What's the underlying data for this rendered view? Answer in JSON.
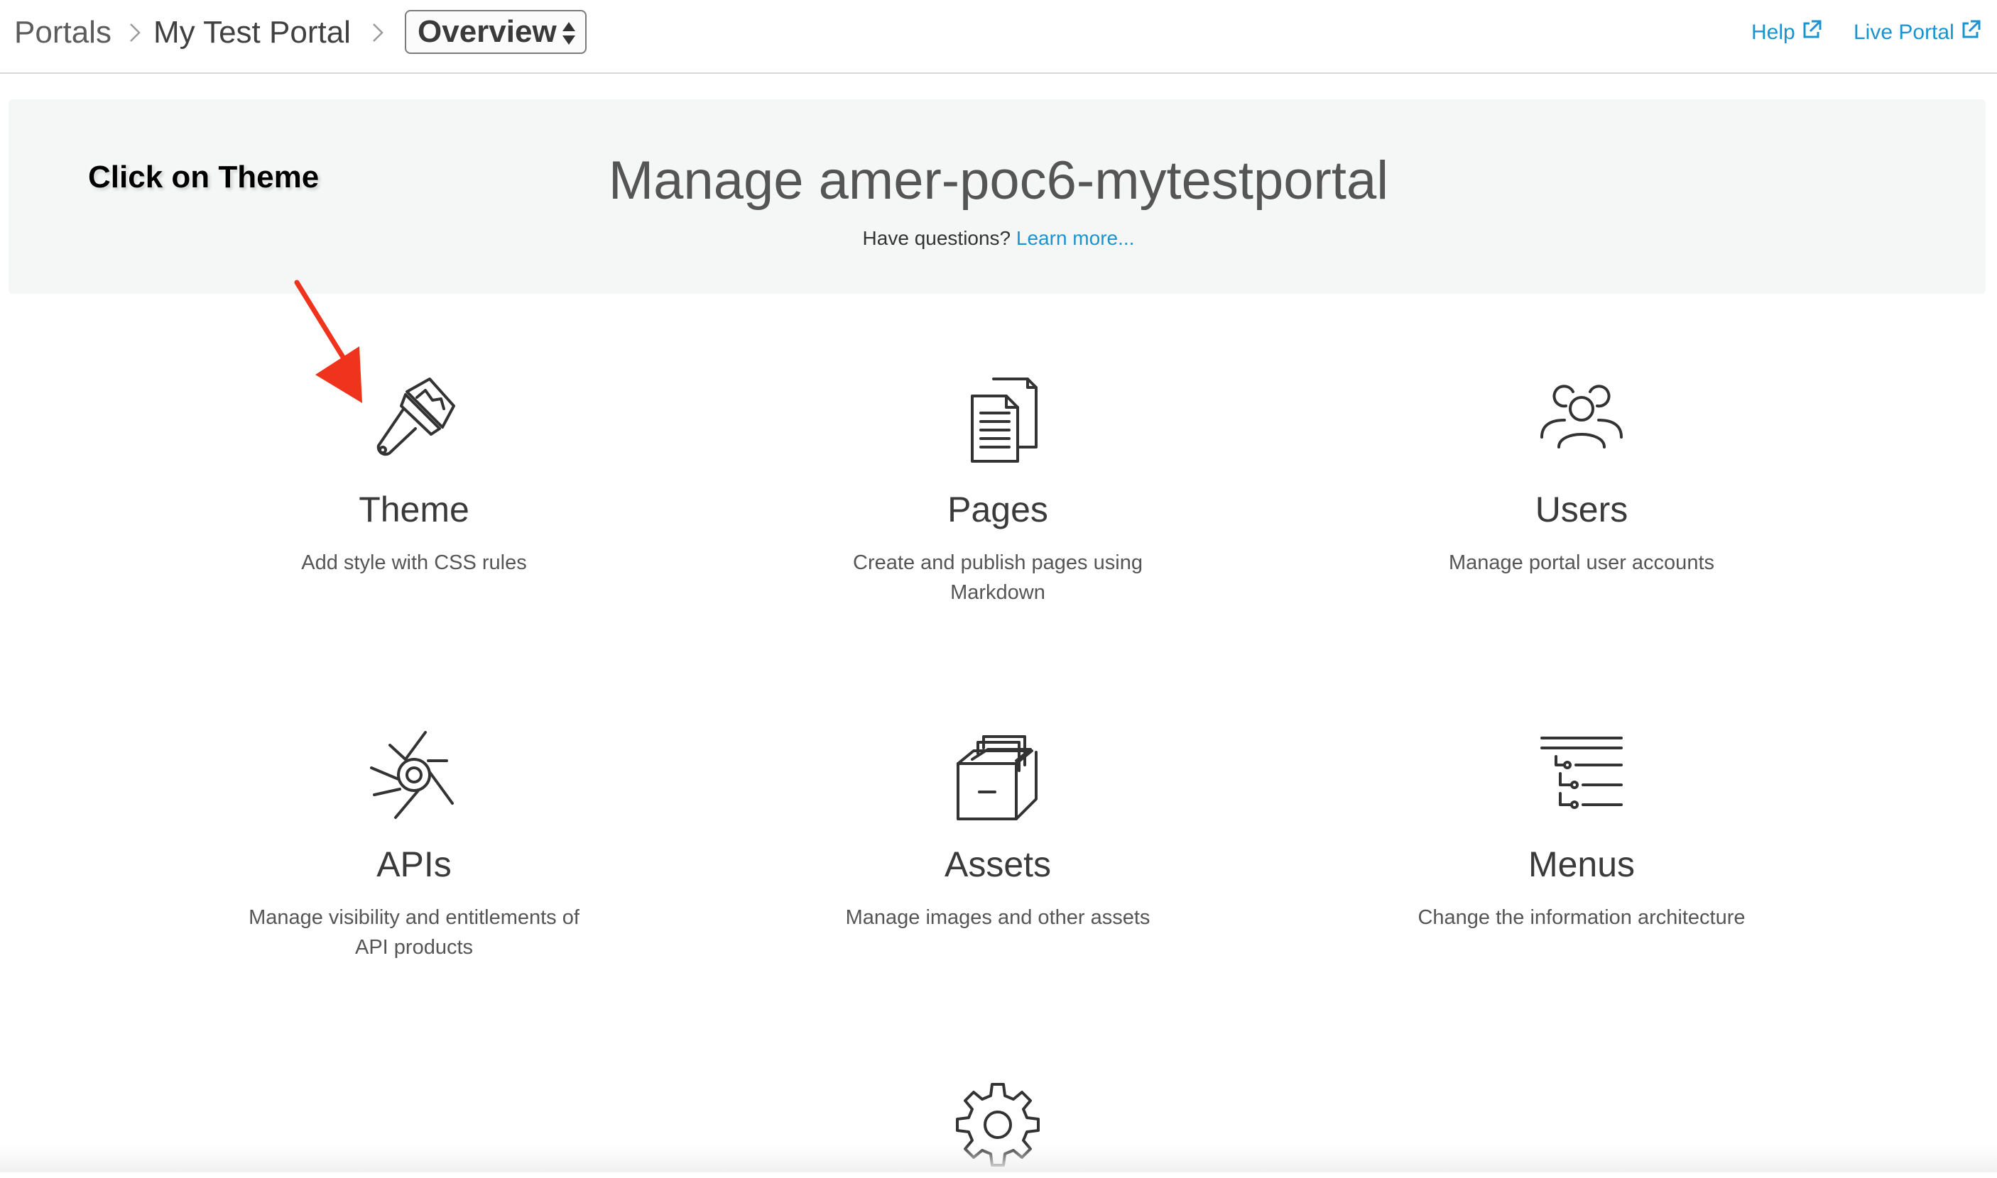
{
  "breadcrumb": {
    "portals": "Portals",
    "portal_name": "My Test Portal",
    "section_select": "Overview"
  },
  "toplinks": {
    "help": "Help",
    "live_portal": "Live Portal"
  },
  "annotation": {
    "text": "Click on Theme"
  },
  "banner": {
    "title": "Manage amer-poc6-mytestportal",
    "question": "Have questions?",
    "learn_more": "Learn more..."
  },
  "tiles": [
    {
      "title": "Theme",
      "desc": "Add style with CSS rules",
      "icon": "paintbrush-icon"
    },
    {
      "title": "Pages",
      "desc": "Create and publish pages using Markdown",
      "icon": "pages-icon"
    },
    {
      "title": "Users",
      "desc": "Manage portal user accounts",
      "icon": "users-icon"
    },
    {
      "title": "APIs",
      "desc": "Manage visibility and entitlements of API products",
      "icon": "apis-icon"
    },
    {
      "title": "Assets",
      "desc": "Manage images and other assets",
      "icon": "assets-icon"
    },
    {
      "title": "Menus",
      "desc": "Change the information architecture",
      "icon": "menus-icon"
    },
    {
      "title": "",
      "desc": "",
      "icon": "gear-icon"
    }
  ],
  "colors": {
    "link": "#1a93d1",
    "annotation_arrow": "#f0331c",
    "banner_bg": "#f5f6f6"
  }
}
